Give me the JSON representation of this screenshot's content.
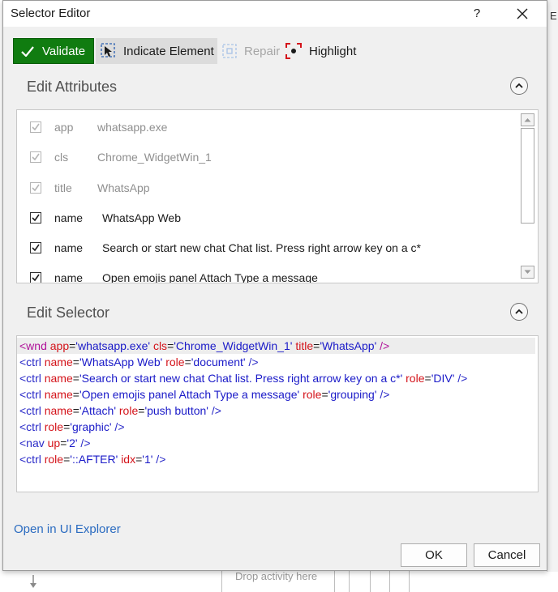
{
  "dialog": {
    "title": "Selector Editor",
    "help_label": "?",
    "close_icon": "close-icon"
  },
  "toolbar": {
    "validate_label": "Validate",
    "indicate_label": "Indicate Element",
    "repair_label": "Repair",
    "highlight_label": "Highlight"
  },
  "edit_attributes": {
    "heading": "Edit Attributes",
    "rows": [
      {
        "name": "app",
        "value": "whatsapp.exe",
        "checked": true,
        "disabled": true
      },
      {
        "name": "cls",
        "value": "Chrome_WidgetWin_1",
        "checked": true,
        "disabled": true
      },
      {
        "name": "title",
        "value": "WhatsApp",
        "checked": true,
        "disabled": true
      },
      {
        "name": "name",
        "value": "WhatsApp Web",
        "checked": true,
        "disabled": false
      },
      {
        "name": "name",
        "value": "Search or start new chat Chat list. Press right arrow key on a c*",
        "checked": true,
        "disabled": false
      },
      {
        "name": "name",
        "value": "Open emojis panel Attach Type a message",
        "checked": true,
        "disabled": false
      }
    ]
  },
  "edit_selector": {
    "heading": "Edit Selector",
    "lines": [
      {
        "tag": "wnd",
        "attrs": [
          [
            "app",
            "whatsapp.exe"
          ],
          [
            "cls",
            "Chrome_WidgetWin_1"
          ],
          [
            "title",
            "WhatsApp"
          ]
        ]
      },
      {
        "tag": "ctrl",
        "attrs": [
          [
            "name",
            "WhatsApp Web"
          ],
          [
            "role",
            "document"
          ]
        ]
      },
      {
        "tag": "ctrl",
        "attrs": [
          [
            "name",
            "Search or start new chat Chat list. Press right arrow key on a c*"
          ],
          [
            "role",
            "DIV"
          ]
        ]
      },
      {
        "tag": "ctrl",
        "attrs": [
          [
            "name",
            "Open emojis panel Attach Type a message"
          ],
          [
            "role",
            "grouping"
          ]
        ]
      },
      {
        "tag": "ctrl",
        "attrs": [
          [
            "name",
            "Attach"
          ],
          [
            "role",
            "push button"
          ]
        ]
      },
      {
        "tag": "ctrl",
        "attrs": [
          [
            "role",
            "graphic"
          ]
        ]
      },
      {
        "tag": "nav",
        "attrs": [
          [
            "up",
            "2"
          ]
        ]
      },
      {
        "tag": "ctrl",
        "attrs": [
          [
            "role",
            "::AFTER"
          ],
          [
            "idx",
            "1"
          ]
        ]
      }
    ]
  },
  "footer": {
    "explorer_link": "Open in UI Explorer",
    "ok_label": "OK",
    "cancel_label": "Cancel"
  },
  "background": {
    "right_tab_text": "E",
    "bottom_text": "Drop activity here"
  },
  "colors": {
    "validate_green": "#107c10",
    "link_blue": "#2a6bc0",
    "selector_tag": "#2a2ac8",
    "selector_attr": "#d4131a",
    "selector_value": "#1a1ac8"
  }
}
